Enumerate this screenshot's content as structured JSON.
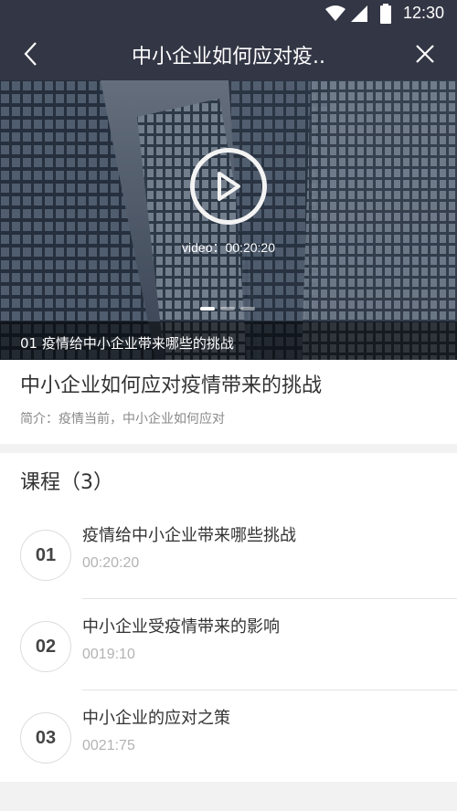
{
  "status_bar": {
    "time": "12:30"
  },
  "nav": {
    "title": "中小企业如何应对疫.."
  },
  "banner": {
    "video_label": "video：00:20:20",
    "caption": "01 疫情给中小企业带来哪些的挑战",
    "slide_count": 3,
    "active_slide": 1
  },
  "info": {
    "title": "中小企业如何应对疫情带来的挑战",
    "description": "简介：疫情当前，中小企业如何应对"
  },
  "courses": {
    "header": "课程（3）",
    "items": [
      {
        "num": "01",
        "title": "疫情给中小企业带来哪些挑战",
        "time": "00:20:20"
      },
      {
        "num": "02",
        "title": "中小企业受疫情带来的影响",
        "time": "0019:10"
      },
      {
        "num": "03",
        "title": "中小企业的应对之策",
        "time": "0021:75"
      }
    ]
  }
}
